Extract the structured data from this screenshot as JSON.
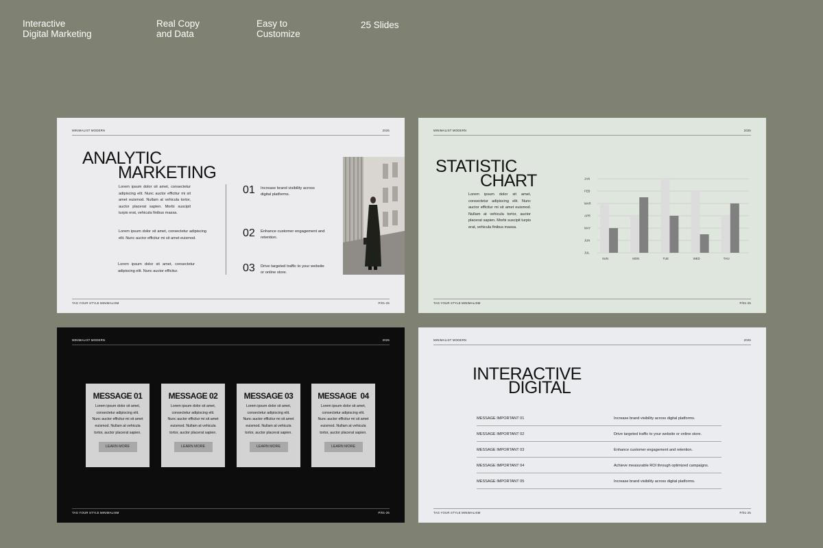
{
  "features": [
    {
      "line1": "Interactive",
      "line2": "Digital Marketing"
    },
    {
      "line1": "Real Copy",
      "line2": "and Data"
    },
    {
      "line1": "Easy to",
      "line2": "Customize"
    },
    {
      "line1": "25 Slides",
      "line2": ""
    }
  ],
  "common": {
    "header_left": "MINIMALIST MODERN",
    "header_right": "2025",
    "footer_left": "TAG YOUR STYLE MINIMALISM",
    "footer_right": "P/01-25"
  },
  "slide1": {
    "title1": "ANALYTIC",
    "title2": "MARKETING",
    "para1": "Lorem ipsum dolor sit amet, consectetur adipiscing elit. Nunc auctor efficitur mi sit amet euismod. Nullam at vehicula tortor, auctor placerat sapien. Morbi suscipit turpis erat, vehicula finibus massa.",
    "para2": "Lorem ipsum dolor sit amet, consectetur adipiscing elit. Nunc auctor efficitur mi sit amet euismod.",
    "para3": "Lorem ipsum dolor sit amet, consectetur adipiscing elit. Nunc auctor efficitur.",
    "points": [
      {
        "num": "01",
        "text": "Increase brand visibility across digital platforms."
      },
      {
        "num": "02",
        "text": "Enhance customer engagement and retention."
      },
      {
        "num": "03",
        "text": "Drive targeted traffic to your website or online store."
      }
    ]
  },
  "slide2": {
    "title1": "STATISTIC",
    "title2": "CHART",
    "para": "Lorem ipsum dolor sit amet, consectetur adipiscing elit. Nunc auctor efficitur mi sit amet euismod. Nullam at vehicula tortor, auctor placerat sapien. Morbi suscipit turpis erat, vehicula finibus massa."
  },
  "chart_data": {
    "type": "bar",
    "categories": [
      "SUN",
      "MON",
      "TUE",
      "WED",
      "THU"
    ],
    "y_ticks": [
      "JAN",
      "FEB",
      "MAR",
      "APR",
      "MAY",
      "JUN",
      "JUL"
    ],
    "series": [
      {
        "values": [
          4,
          3,
          6,
          5,
          3
        ],
        "color": "#dcdcdc"
      },
      {
        "values": [
          2,
          4.5,
          3,
          1.5,
          4
        ],
        "color": "#808080"
      }
    ],
    "ylim": [
      0,
      6
    ]
  },
  "slide3": {
    "cards": [
      {
        "title": "MESSAGE 01",
        "body": "Lorem ipsum dolor sit amet, consectetur adipiscing elit. Nunc auctor efficitur mi sit amet euismod. Nullam at vehicula tortor, auctor placerat sapien.",
        "button": "LEARN MORE"
      },
      {
        "title": "MESSAGE 02",
        "body": "Lorem ipsum dolor sit amet, consectetur adipiscing elit. Nunc auctor efficitur mi sit amet euismod. Nullam at vehicula tortor, auctor placerat sapien.",
        "button": "LEARN MORE"
      },
      {
        "title": "MESSAGE 03",
        "body": "Lorem ipsum dolor sit amet, consectetur adipiscing elit. Nunc auctor efficitur mi sit amet euismod. Nullam at vehicula tortor, auctor placerat sapien.",
        "button": "LEARN MORE"
      },
      {
        "title": "MESSAGE  04",
        "body": "Lorem ipsum dolor sit amet, consectetur adipiscing elit. Nunc auctor efficitur mi sit amet euismod. Nullam at vehicula tortor, auctor placerat sapien.",
        "button": "LEARN MORE"
      }
    ]
  },
  "slide4": {
    "title1": "INTERACTIVE",
    "title2": "DIGITAL",
    "rows": [
      {
        "label": "MESSAGE IMPORTANT 01",
        "text": "Increase brand visibility across digital platforms."
      },
      {
        "label": "MESSAGE IMPORTANT 02",
        "text": "Drive targeted traffic to your website or online store."
      },
      {
        "label": "MESSAGE IMPORTANT 03",
        "text": "Enhance customer engagement and retention."
      },
      {
        "label": "MESSAGE IMPORTANT 04",
        "text": "Achieve measurable ROI through optimized campaigns."
      },
      {
        "label": "MESSAGE IMPORTANT 05",
        "text": "Increase brand visibility across digital platforms."
      }
    ]
  }
}
